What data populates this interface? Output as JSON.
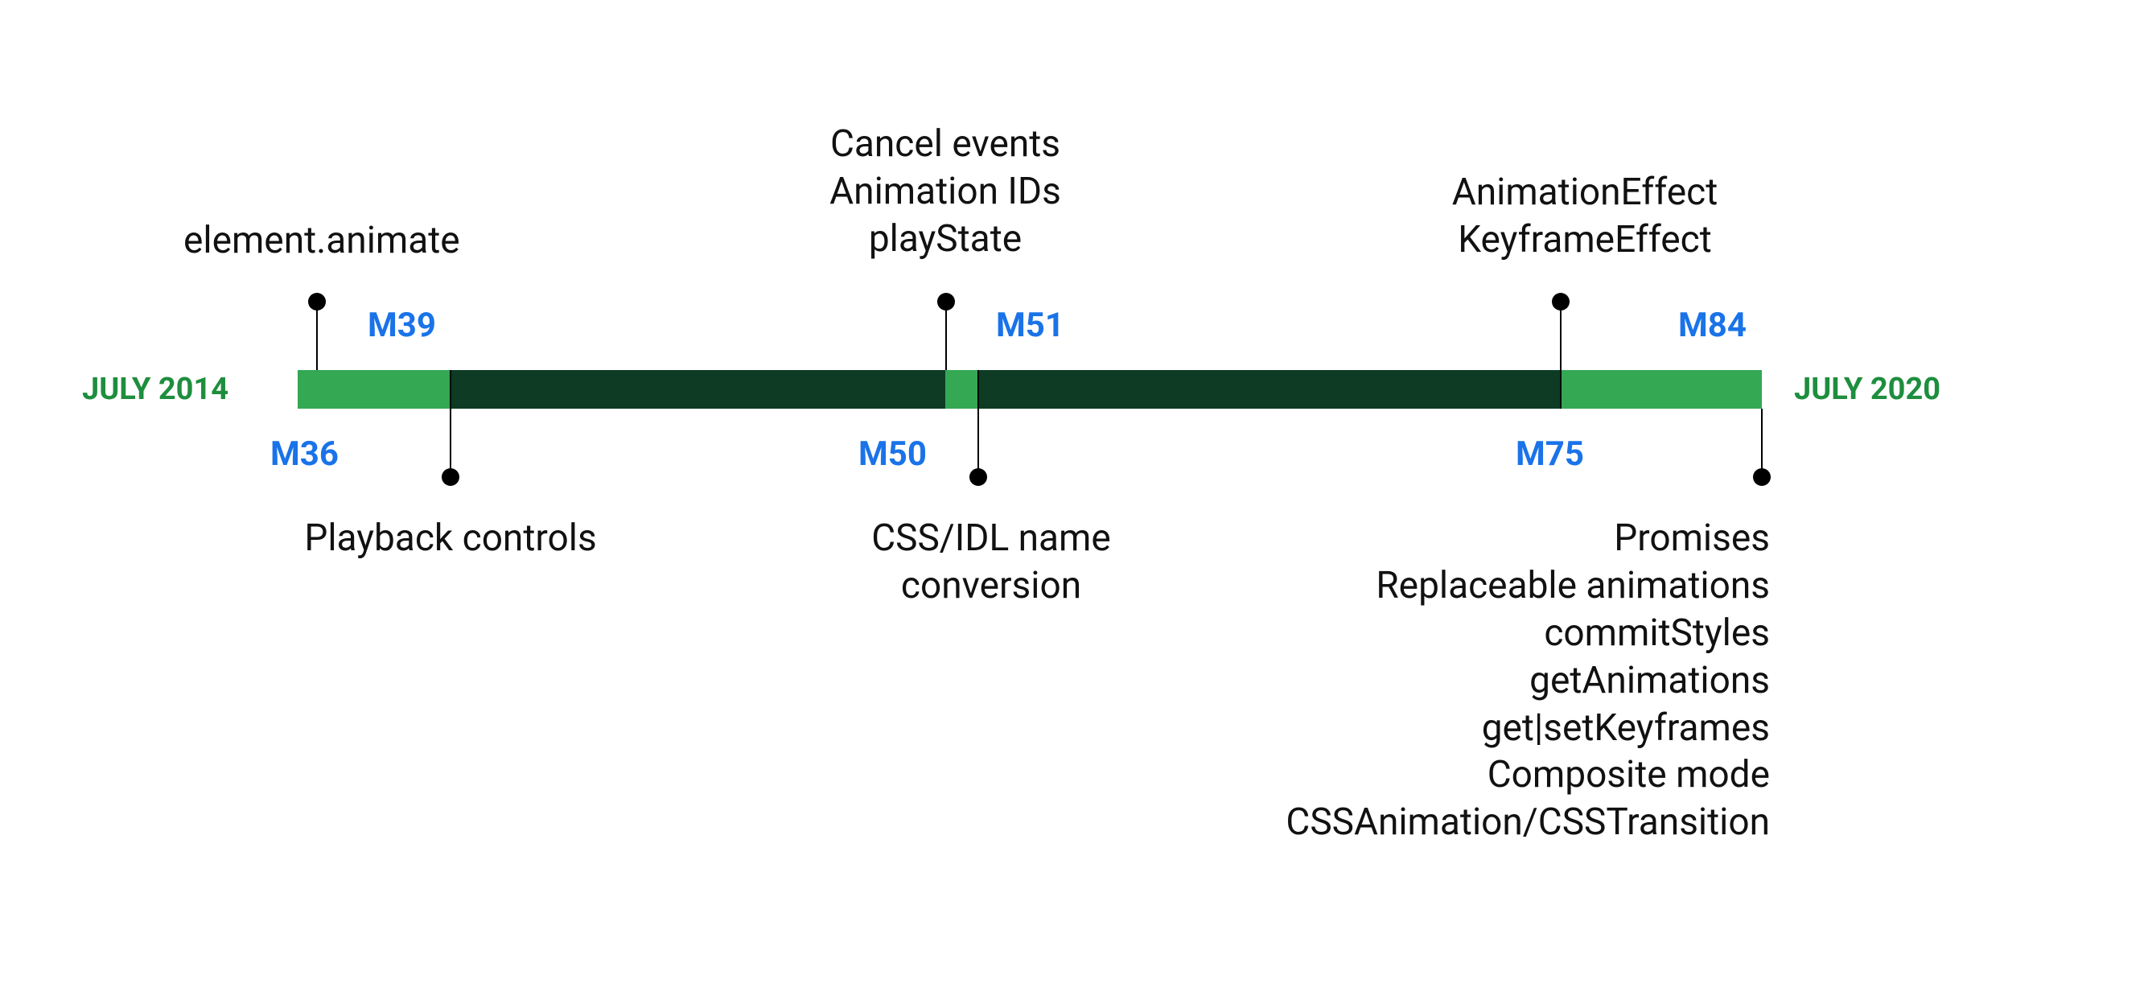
{
  "start_label": "JULY 2014",
  "end_label": "JULY 2020",
  "milestones": {
    "m36": {
      "label": "M36",
      "desc_lines": [
        "element.animate"
      ]
    },
    "m39": {
      "label": "M39",
      "desc_lines": [
        "Playback controls"
      ]
    },
    "m50": {
      "label": "M50",
      "desc_lines": [
        "CSS/IDL name",
        "conversion"
      ]
    },
    "m51": {
      "label": "M51",
      "desc_lines": [
        "Cancel events",
        "Animation IDs",
        "playState"
      ]
    },
    "m75": {
      "label": "M75",
      "desc_lines": [
        "AnimationEffect",
        "KeyframeEffect"
      ]
    },
    "m84": {
      "label": "M84",
      "desc_lines": [
        "Promises",
        "Replaceable animations",
        "commitStyles",
        "getAnimations",
        "get|setKeyframes",
        "Composite mode",
        "CSSAnimation/CSSTransition"
      ]
    }
  },
  "chart_data": {
    "type": "timeline",
    "title": "Web Animations API features by Chrome milestone",
    "range": {
      "start": "2014-07",
      "end": "2020-07"
    },
    "series": [
      {
        "milestone": "M36",
        "position": "above",
        "features": [
          "element.animate"
        ]
      },
      {
        "milestone": "M39",
        "position": "below",
        "features": [
          "Playback controls"
        ]
      },
      {
        "milestone": "M50",
        "position": "below",
        "features": [
          "CSS/IDL name conversion"
        ]
      },
      {
        "milestone": "M51",
        "position": "above",
        "features": [
          "Cancel events",
          "Animation IDs",
          "playState"
        ]
      },
      {
        "milestone": "M75",
        "position": "above",
        "features": [
          "AnimationEffect",
          "KeyframeEffect"
        ]
      },
      {
        "milestone": "M84",
        "position": "below",
        "features": [
          "Promises",
          "Replaceable animations",
          "commitStyles",
          "getAnimations",
          "get|setKeyframes",
          "Composite mode",
          "CSSAnimation/CSSTransition"
        ]
      }
    ],
    "colors": {
      "bar_light": "#34a853",
      "bar_dark": "#0d3b24",
      "milestone_label": "#1a73e8",
      "end_label": "#1e8e3e"
    }
  }
}
